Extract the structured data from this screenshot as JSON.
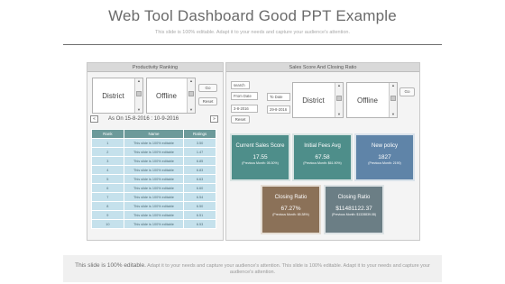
{
  "slide": {
    "title": "Web Tool Dashboard Good PPT Example",
    "subtitle": "This slide is 100% editable. Adapt it to your needs and capture your audience's attention."
  },
  "productivity": {
    "header": "Productivity Ranking",
    "district_label": "District",
    "offline_label": "Offline",
    "go_label": "Go",
    "reset_label": "Reset",
    "prev_icon": "prev-arrow-icon",
    "next_icon": "next-arrow-icon",
    "prev_glyph": "«",
    "next_glyph": "»",
    "date_range": "As On  15-8-2016 : 10-9-2016",
    "table": {
      "columns": [
        "Rank",
        "Name",
        "Ratings"
      ],
      "rows": [
        [
          "1",
          "This slide is 100% editable",
          "3.50"
        ],
        [
          "2",
          "This slide is 100% editable",
          "1.47"
        ],
        [
          "3",
          "This slide is 100% editable",
          "6.85"
        ],
        [
          "4",
          "This slide is 100% editable",
          "6.83"
        ],
        [
          "5",
          "This slide is 100% editable",
          "6.63"
        ],
        [
          "6",
          "This slide is 100% editable",
          "6.60"
        ],
        [
          "7",
          "This slide is 100% editable",
          "6.54"
        ],
        [
          "8",
          "This slide is 100% editable",
          "6.50"
        ],
        [
          "9",
          "This slide is 100% editable",
          "6.51"
        ],
        [
          "10",
          "This slide is 100% editable",
          "6.53"
        ]
      ]
    }
  },
  "sales": {
    "header": "Sales Score And Closing Ratio",
    "search_label": "search",
    "from_date_label": "From Date",
    "to_date_label": "To Date",
    "from_date_value": "3-8-2016",
    "to_date_value": "29-8-2016",
    "reset_label": "Reset",
    "district_label": "District",
    "offline_label": "Offline",
    "go_label": "Go",
    "kpis": [
      {
        "label": "Current Sales Score",
        "value": "17.55",
        "prev": "(Previous Month: 05.30%)"
      },
      {
        "label": "Initial Fees Avg",
        "value": "67.58",
        "prev": "(Previous Month: $61.90%)"
      },
      {
        "label": "New policy",
        "value": "1827",
        "prev": "(Previous Month: 2190)"
      },
      {
        "label": "Closing Ratio",
        "value": "67.27%",
        "prev": "(Previous Month: 65.38%)"
      },
      {
        "label": "Closing Ratio",
        "value": "$11481122.37",
        "prev": "(Previous Month: $1328839.08)"
      }
    ]
  },
  "footer": {
    "lead": "This slide is 100% editable.",
    "text": "Adapt it to your needs and capture your audience's attention. This slide is 100% editable. Adapt it to your needs and capture your audience's attention."
  },
  "colors": {
    "table_header": "#6c9a9a",
    "table_cell": "#c5e1ec",
    "kpi_teal": "#4e8e8a",
    "kpi_blue": "#5f84a8",
    "kpi_brown": "#8b7158",
    "kpi_gray": "#6b7e85"
  }
}
